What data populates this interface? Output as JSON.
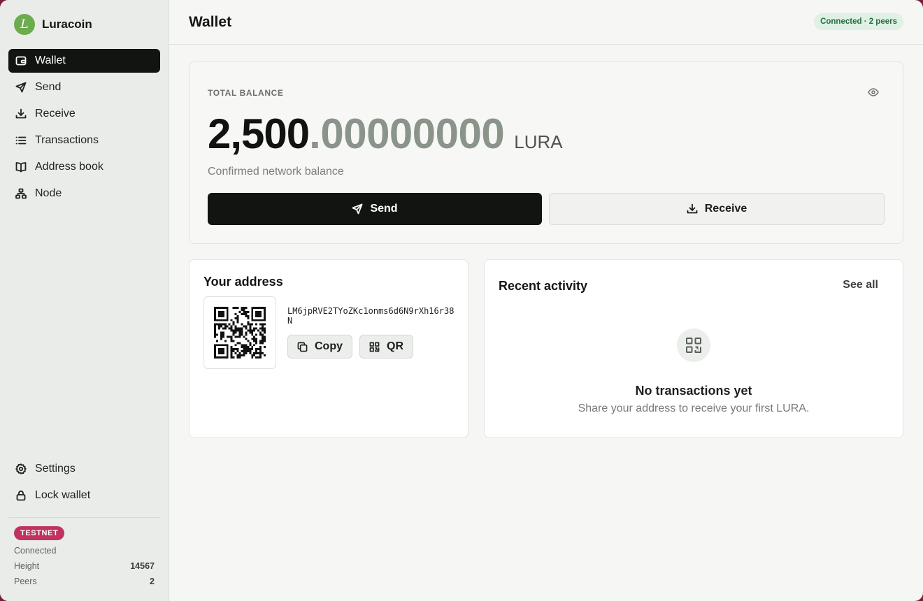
{
  "brand": {
    "name": "Luracoin",
    "logo_letter": "L",
    "logo_color": "#6cab4e"
  },
  "sidebar": {
    "items": [
      {
        "label": "Wallet",
        "icon": "wallet-icon",
        "active": true
      },
      {
        "label": "Send",
        "icon": "send-icon"
      },
      {
        "label": "Receive",
        "icon": "download-icon"
      },
      {
        "label": "Transactions",
        "icon": "list-icon"
      },
      {
        "label": "Address book",
        "icon": "book-icon"
      },
      {
        "label": "Node",
        "icon": "network-icon"
      }
    ],
    "bottom_items": [
      {
        "label": "Settings",
        "icon": "gear-icon"
      },
      {
        "label": "Lock wallet",
        "icon": "lock-icon"
      }
    ],
    "network": {
      "badge": "TESTNET",
      "badge_color": "#c0335e",
      "status": "Connected",
      "height_label": "Height",
      "height_value": "14567",
      "peers_label": "Peers",
      "peers_value": "2"
    }
  },
  "header": {
    "title": "Wallet",
    "status": "Connected · 2 peers",
    "status_color": "#2a6b45"
  },
  "balance": {
    "label": "TOTAL BALANCE",
    "integer": "2,500",
    "fraction": ".00000000",
    "unit": "LURA",
    "subtitle": "Confirmed network balance",
    "send_label": "Send",
    "receive_label": "Receive"
  },
  "address": {
    "title": "Your address",
    "value": "LM6jpRVE2TYoZKc1onms6d6N9rXh16r38N",
    "copy_label": "Copy",
    "qr_label": "QR"
  },
  "activity": {
    "title": "Recent activity",
    "see_all": "See all",
    "empty_title": "No transactions yet",
    "empty_subtitle": "Share your address to receive your first LURA."
  }
}
